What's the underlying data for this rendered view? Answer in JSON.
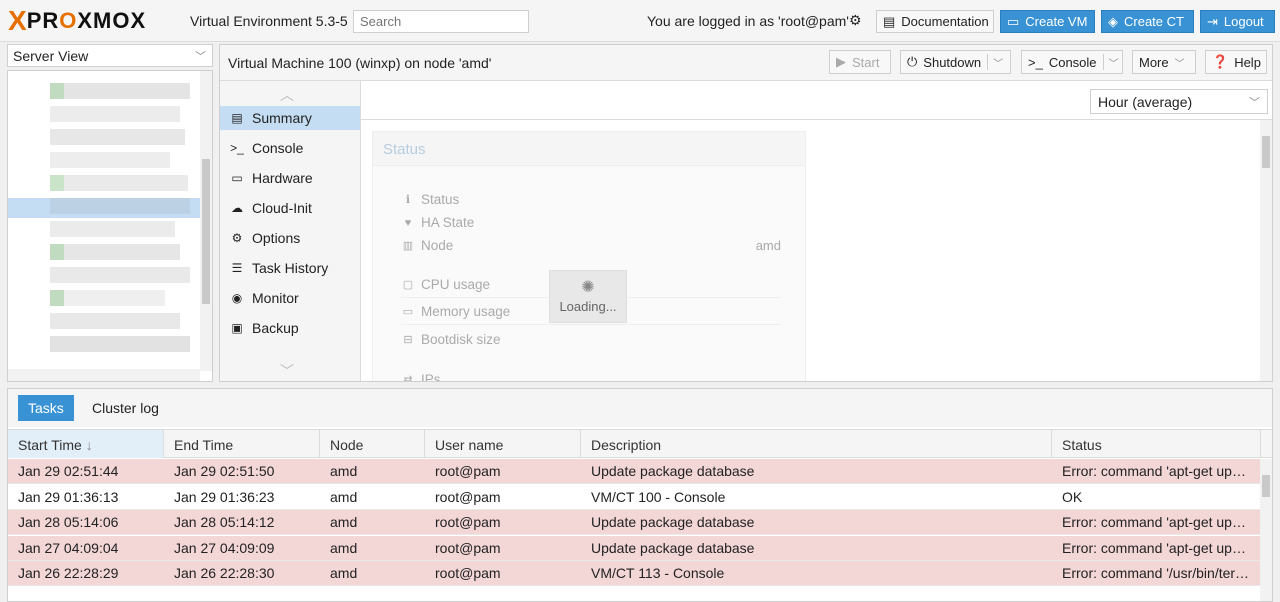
{
  "header": {
    "logo_x": "X",
    "logo_word_pre": "PR",
    "logo_word_o": "O",
    "logo_word_post": "XMOX",
    "version": "Virtual Environment 5.3-5",
    "search_placeholder": "Search",
    "login_text": "You are logged in as 'root@pam'",
    "documentation_label": "Documentation",
    "create_vm_label": "Create VM",
    "create_ct_label": "Create CT",
    "logout_label": "Logout"
  },
  "sidebar": {
    "view_select": "Server View"
  },
  "vm": {
    "title": "Virtual Machine 100 (winxp) on node 'amd'",
    "toolbar": {
      "start": "Start",
      "shutdown": "Shutdown",
      "console": "Console",
      "more": "More",
      "help": "Help"
    },
    "nav": [
      {
        "label": "Summary",
        "icon": "book-icon",
        "glyph": "▤"
      },
      {
        "label": "Console",
        "icon": "terminal-icon",
        "glyph": ">_"
      },
      {
        "label": "Hardware",
        "icon": "monitor-icon",
        "glyph": "▭"
      },
      {
        "label": "Cloud-Init",
        "icon": "cloud-icon",
        "glyph": "☁"
      },
      {
        "label": "Options",
        "icon": "gear-icon",
        "glyph": "⚙"
      },
      {
        "label": "Task History",
        "icon": "list-icon",
        "glyph": "☰"
      },
      {
        "label": "Monitor",
        "icon": "eye-icon",
        "glyph": "◉"
      },
      {
        "label": "Backup",
        "icon": "floppy-icon",
        "glyph": "▣"
      }
    ],
    "range_select": "Hour (average)",
    "status": {
      "title": "Status",
      "rows": [
        {
          "label": "Status",
          "icon": "info-icon",
          "glyph": "ℹ",
          "value": ""
        },
        {
          "label": "HA State",
          "icon": "heartbeat-icon",
          "glyph": "♥",
          "value": ""
        },
        {
          "label": "Node",
          "icon": "building-icon",
          "glyph": "▥",
          "value": "amd"
        },
        {
          "label": "CPU usage",
          "icon": "cpu-icon",
          "glyph": "▢",
          "value": ""
        },
        {
          "label": "Memory usage",
          "icon": "memory-icon",
          "glyph": "▭",
          "value": ""
        },
        {
          "label": "Bootdisk size",
          "icon": "hdd-icon",
          "glyph": "⊟",
          "value": ""
        },
        {
          "label": "IPs",
          "icon": "exchange-icon",
          "glyph": "⇄",
          "value": ""
        }
      ],
      "loading": "Loading..."
    }
  },
  "log": {
    "tabs": [
      "Tasks",
      "Cluster log"
    ],
    "columns": [
      "Start Time",
      "End Time",
      "Node",
      "User name",
      "Description",
      "Status"
    ],
    "rows": [
      {
        "start": "Jan 29 02:51:44",
        "end": "Jan 29 02:51:50",
        "node": "amd",
        "user": "root@pam",
        "desc": "Update package database",
        "status": "Error: command 'apt-get upd…",
        "error": true
      },
      {
        "start": "Jan 29 01:36:13",
        "end": "Jan 29 01:36:23",
        "node": "amd",
        "user": "root@pam",
        "desc": "VM/CT 100 - Console",
        "status": "OK",
        "error": false
      },
      {
        "start": "Jan 28 05:14:06",
        "end": "Jan 28 05:14:12",
        "node": "amd",
        "user": "root@pam",
        "desc": "Update package database",
        "status": "Error: command 'apt-get upd…",
        "error": true
      },
      {
        "start": "Jan 27 04:09:04",
        "end": "Jan 27 04:09:09",
        "node": "amd",
        "user": "root@pam",
        "desc": "Update package database",
        "status": "Error: command 'apt-get upd…",
        "error": true
      },
      {
        "start": "Jan 26 22:28:29",
        "end": "Jan 26 22:28:30",
        "node": "amd",
        "user": "root@pam",
        "desc": "VM/CT 113 - Console",
        "status": "Error: command '/usr/bin/ter…",
        "error": true
      }
    ]
  }
}
